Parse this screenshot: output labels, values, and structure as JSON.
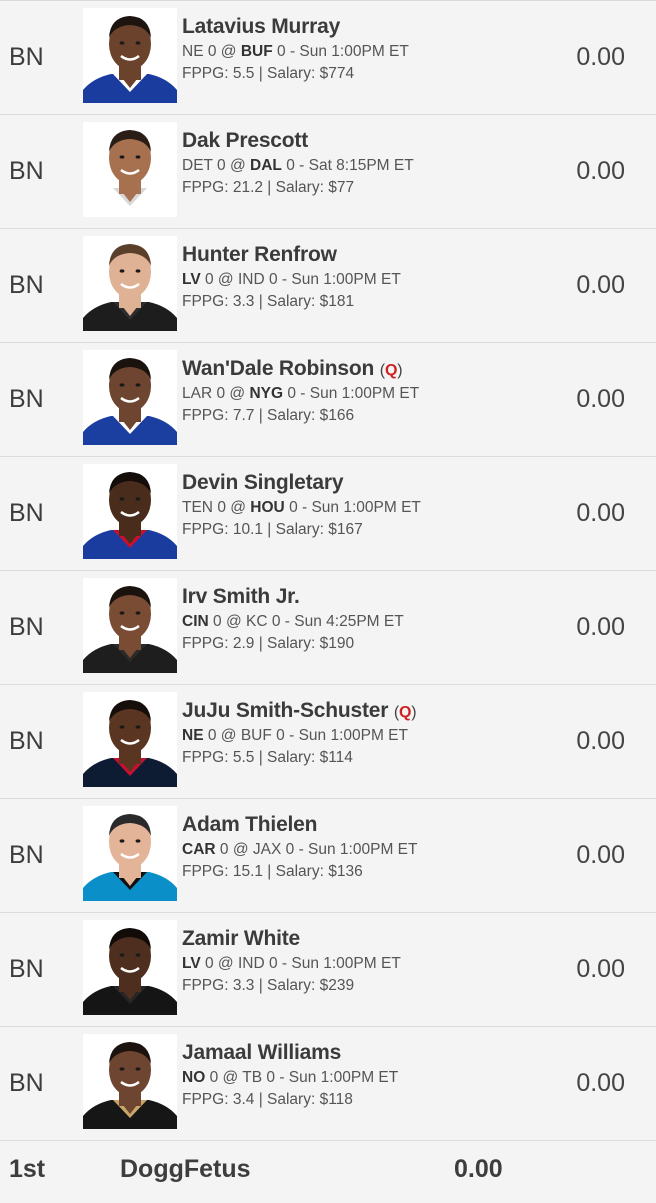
{
  "players": [
    {
      "slot": "BN",
      "name": "Latavius Murray",
      "q": false,
      "away": "NE",
      "away_score": "0",
      "home": "BUF",
      "home_score": "0",
      "bold": "home",
      "time": "Sun 1:00PM ET",
      "fppg": "5.5",
      "salary": "$774",
      "points": "0.00",
      "jersey": "#1a3c9e",
      "collar": "#ffffff",
      "skin": "#6b432c",
      "hair": "#1d140f"
    },
    {
      "slot": "BN",
      "name": "Dak Prescott",
      "q": false,
      "away": "DET",
      "away_score": "0",
      "home": "DAL",
      "home_score": "0",
      "bold": "home",
      "time": "Sat 8:15PM ET",
      "fppg": "21.2",
      "salary": "$77",
      "points": "0.00",
      "jersey": "#ffffff",
      "collar": "#d8d8d8",
      "skin": "#a7714f",
      "hair": "#2a1d16"
    },
    {
      "slot": "BN",
      "name": "Hunter Renfrow",
      "q": false,
      "away": "LV",
      "away_score": "0",
      "home": "IND",
      "home_score": "0",
      "bold": "away",
      "time": "Sun 1:00PM ET",
      "fppg": "3.3",
      "salary": "$181",
      "points": "0.00",
      "jersey": "#1d1d1d",
      "collar": "#2d2d2d",
      "skin": "#e0b295",
      "hair": "#5a3f2b"
    },
    {
      "slot": "BN",
      "name": "Wan'Dale Robinson",
      "q": true,
      "away": "LAR",
      "away_score": "0",
      "home": "NYG",
      "home_score": "0",
      "bold": "home",
      "time": "Sun 1:00PM ET",
      "fppg": "7.7",
      "salary": "$166",
      "points": "0.00",
      "jersey": "#1b3fa0",
      "collar": "#ffffff",
      "skin": "#6d4530",
      "hair": "#1a120d"
    },
    {
      "slot": "BN",
      "name": "Devin Singletary",
      "q": false,
      "away": "TEN",
      "away_score": "0",
      "home": "HOU",
      "home_score": "0",
      "bold": "home",
      "time": "Sun 1:00PM ET",
      "fppg": "10.1",
      "salary": "$167",
      "points": "0.00",
      "jersey": "#1a3c9e",
      "collar": "#c8102e",
      "skin": "#4a2c1c",
      "hair": "#140d09"
    },
    {
      "slot": "BN",
      "name": "Irv Smith Jr.",
      "q": false,
      "away": "CIN",
      "away_score": "0",
      "home": "KC",
      "home_score": "0",
      "bold": "away",
      "time": "Sun 4:25PM ET",
      "fppg": "2.9",
      "salary": "$190",
      "points": "0.00",
      "jersey": "#1e1e1e",
      "collar": "#2b2b2b",
      "skin": "#7a4c33",
      "hair": "#1a120d"
    },
    {
      "slot": "BN",
      "name": "JuJu Smith-Schuster",
      "q": true,
      "away": "NE",
      "away_score": "0",
      "home": "BUF",
      "home_score": "0",
      "bold": "away",
      "time": "Sun 1:00PM ET",
      "fppg": "5.5",
      "salary": "$114",
      "points": "0.00",
      "jersey": "#0d1b33",
      "collar": "#c8102e",
      "skin": "#5a3522",
      "hair": "#150e0a"
    },
    {
      "slot": "BN",
      "name": "Adam Thielen",
      "q": false,
      "away": "CAR",
      "away_score": "0",
      "home": "JAX",
      "home_score": "0",
      "bold": "away",
      "time": "Sun 1:00PM ET",
      "fppg": "15.1",
      "salary": "$136",
      "points": "0.00",
      "jersey": "#0a8fc9",
      "collar": "#101010",
      "skin": "#e3b497",
      "hair": "#2a2a2a"
    },
    {
      "slot": "BN",
      "name": "Zamir White",
      "q": false,
      "away": "LV",
      "away_score": "0",
      "home": "IND",
      "home_score": "0",
      "bold": "away",
      "time": "Sun 1:00PM ET",
      "fppg": "3.3",
      "salary": "$239",
      "points": "0.00",
      "jersey": "#151515",
      "collar": "#262626",
      "skin": "#4e2f1f",
      "hair": "#120c08"
    },
    {
      "slot": "BN",
      "name": "Jamaal Williams",
      "q": false,
      "away": "NO",
      "away_score": "0",
      "home": "TB",
      "home_score": "0",
      "bold": "away",
      "time": "Sun 1:00PM ET",
      "fppg": "3.4",
      "salary": "$118",
      "points": "0.00",
      "jersey": "#161616",
      "collar": "#c9a668",
      "skin": "#6e4530",
      "hair": "#1c130e"
    }
  ],
  "labels": {
    "injury_mark": "Q",
    "fppg_prefix": "FPPG:",
    "salary_prefix": "Salary:"
  },
  "footer": {
    "rank": "1st",
    "team": "DoggFetus",
    "score": "0.00"
  }
}
